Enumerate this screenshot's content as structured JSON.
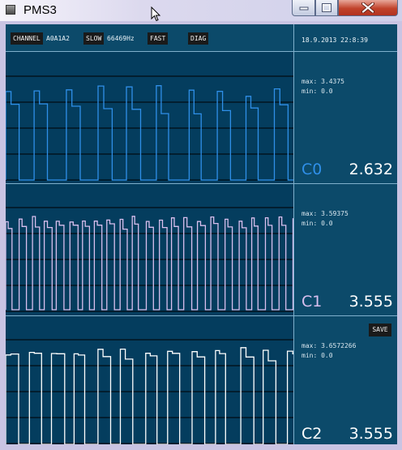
{
  "window": {
    "title": "PMS3",
    "buttons": {
      "minimize": "—",
      "maximize": "□",
      "close": "✕"
    }
  },
  "toolbar": {
    "channel_label": "CHANNEL",
    "channel_value": "A0A1A2",
    "slow_label": "SLOW",
    "frequency": "66469Hz",
    "fast_label": "FAST",
    "diag_label": "DIAG",
    "datetime": "18.9.2013 22:8:39"
  },
  "channels": [
    {
      "name": "C0",
      "max": "max: 3.4375",
      "min": "min: 0.0",
      "value": "2.632",
      "color": "#2f8fe8"
    },
    {
      "name": "C1",
      "max": "max: 3.59375",
      "min": "min: 0.0",
      "value": "3.555",
      "color": "#d9bfee"
    },
    {
      "name": "C2",
      "max": "max: 3.6572266",
      "min": "min: 0.0",
      "value": "3.555",
      "color": "#ffffff"
    }
  ],
  "save_label": "SAVE",
  "colors": {
    "background": "#0c4a6a",
    "plot_background": "#043d5e",
    "separator": "#7fb0cc"
  }
}
